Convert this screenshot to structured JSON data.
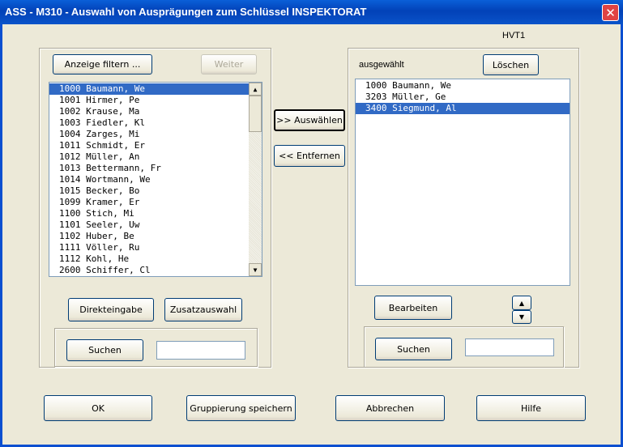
{
  "window": {
    "title": "ASS - M310 - Auswahl von Ausprägungen zum Schlüssel INSPEKTORAT",
    "close_icon": "close-icon",
    "hvt_label": "HVT1"
  },
  "left": {
    "filter_button": "Anzeige filtern ...",
    "weiter_button": "Weiter",
    "items": [
      "1000 Baumann, We",
      "1001 Hirmer, Pe",
      "1002 Krause, Ma",
      "1003 Fiedler, Kl",
      "1004 Zarges, Mi",
      "1011 Schmidt, Er",
      "1012 Müller, An",
      "1013 Bettermann, Fr",
      "1014 Wortmann, We",
      "1015 Becker, Bo",
      "1099 Kramer, Er",
      "1100 Stich, Mi",
      "1101 Seeler, Uw",
      "1102 Huber, Be",
      "1111 Völler, Ru",
      "1112 Kohl, He",
      "2600 Schiffer, Cl"
    ],
    "selected_index": 0,
    "direkteingabe_button": "Direkteingabe",
    "zusatzauswahl_button": "Zusatzauswahl",
    "suchen_button": "Suchen",
    "search_value": ""
  },
  "middle": {
    "auswaehlen_button": ">> Auswählen",
    "entfernen_button": "<< Entfernen"
  },
  "right": {
    "header_label": "ausgewählt",
    "loeschen_button": "Löschen",
    "items": [
      "1000 Baumann, We",
      "3203 Müller, Ge",
      "3400 Siegmund, Al"
    ],
    "selected_index": 2,
    "bearbeiten_button": "Bearbeiten",
    "suchen_button": "Suchen",
    "search_value": ""
  },
  "footer": {
    "ok_button": "OK",
    "gruppierung_button": "Gruppierung speichern",
    "abbrechen_button": "Abbrechen",
    "hilfe_button": "Hilfe"
  }
}
